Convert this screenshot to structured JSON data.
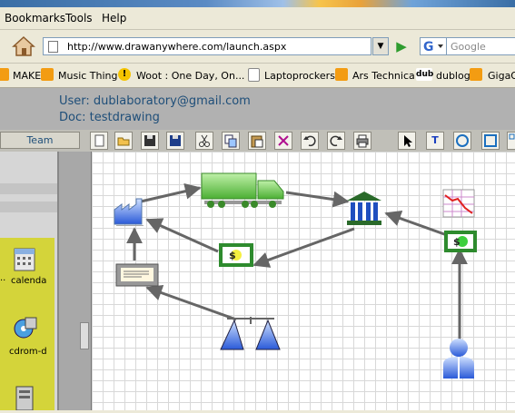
{
  "browser": {
    "menu": [
      "Bookmarks",
      "Tools",
      "Help"
    ],
    "url": "http://www.drawanywhere.com/launch.aspx",
    "search_placeholder": "Google",
    "bookmarks": [
      {
        "label": "MAKE",
        "icon": "rss-icon"
      },
      {
        "label": "Music Thing",
        "icon": "rss-icon"
      },
      {
        "label": "Woot : One Day, On...",
        "icon": "exclamation-icon"
      },
      {
        "label": "Laptoprockers",
        "icon": "page-icon"
      },
      {
        "label": "Ars Technica",
        "icon": "rss-icon"
      },
      {
        "label": "dublog",
        "icon": "dub-icon",
        "badge": "dub"
      },
      {
        "label": "GigaO",
        "icon": "rss-icon"
      }
    ]
  },
  "app": {
    "user_line": "User: dublaboratory@gmail.com",
    "doc_line": "Doc: testdrawing",
    "team_tab": "Team",
    "toolbar": [
      "new-icon",
      "open-icon",
      "save-icon",
      "save-as-icon",
      "cut-icon",
      "copy-icon",
      "paste-icon",
      "delete-icon",
      "undo-icon",
      "redo-icon",
      "print-icon"
    ],
    "draw_tools": [
      "pointer-icon",
      "text-tool-icon",
      "circle-tool-icon",
      "rectangle-tool-icon",
      "connector-tool-icon"
    ],
    "text_tool_glyph": "T",
    "side_items": [
      {
        "label": "calenda",
        "icon": "calendar-icon"
      },
      {
        "label": "cdrom-d",
        "icon": "cdrom-icon"
      }
    ],
    "side_item_prefix": "··",
    "colors": {
      "accent": "#1e4e79",
      "header_bg": "#b1b1b1",
      "side_panel": "#d4d43a",
      "shape_green": "#2e8b2e",
      "shape_blue": "#3a6fd8"
    }
  },
  "diagram": {
    "shapes": [
      "factory-icon",
      "truck-icon",
      "bank-icon",
      "chart-icon",
      "money-box-icon",
      "money-box-icon",
      "document-icon",
      "scale-icon",
      "person-icon"
    ],
    "money_symbol": "$"
  }
}
